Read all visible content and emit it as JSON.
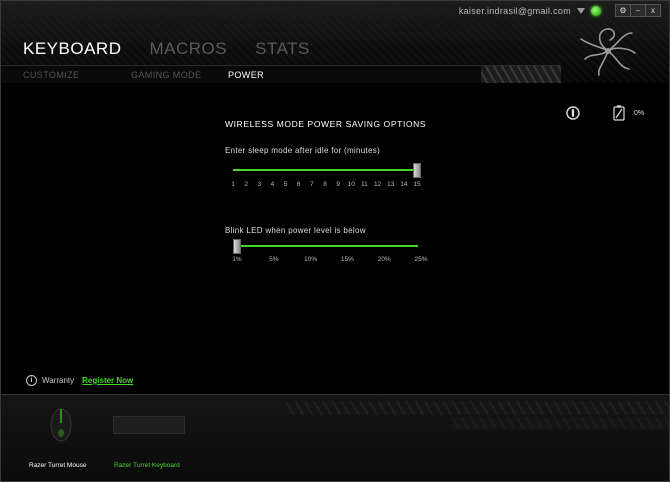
{
  "user": {
    "email": "kaiser.indrasil@gmail.com"
  },
  "window_controls": {
    "settings": "⚙",
    "minimize": "–",
    "close": "x"
  },
  "main_tabs": [
    {
      "label": "KEYBOARD",
      "active": true
    },
    {
      "label": "MACROS",
      "active": false
    },
    {
      "label": "STATS",
      "active": false
    }
  ],
  "sub_tabs": [
    {
      "label": "CUSTOMIZE",
      "active": false
    },
    {
      "label": "GAMING MODE",
      "active": false
    },
    {
      "label": "POWER",
      "active": true
    }
  ],
  "power": {
    "section_title": "WIRELESS MODE POWER SAVING OPTIONS",
    "sleep": {
      "label": "Enter sleep mode after idle for (minutes)",
      "ticks": [
        "1",
        "2",
        "3",
        "4",
        "5",
        "6",
        "7",
        "8",
        "9",
        "10",
        "11",
        "12",
        "13",
        "14",
        "15"
      ],
      "value": 15,
      "min": 1,
      "max": 15
    },
    "blink": {
      "label": "Blink LED when power level is below",
      "ticks": [
        "1%",
        "5%",
        "10%",
        "15%",
        "20%",
        "25%"
      ],
      "value": 1,
      "min": 1,
      "max": 25
    }
  },
  "status": {
    "mouse_icon": "mouse-status-icon",
    "battery_icon": "battery-icon",
    "battery_level": "0%"
  },
  "warranty": {
    "label": "Warranty",
    "link": "Register Now"
  },
  "devices": [
    {
      "name": "Razer Turret Mouse",
      "selected": false,
      "color": "#ffffff"
    },
    {
      "name": "Razer Turret Keyboard",
      "selected": true,
      "color": "#44d62c"
    }
  ],
  "colors": {
    "accent": "#44d62c",
    "background": "#000000"
  }
}
